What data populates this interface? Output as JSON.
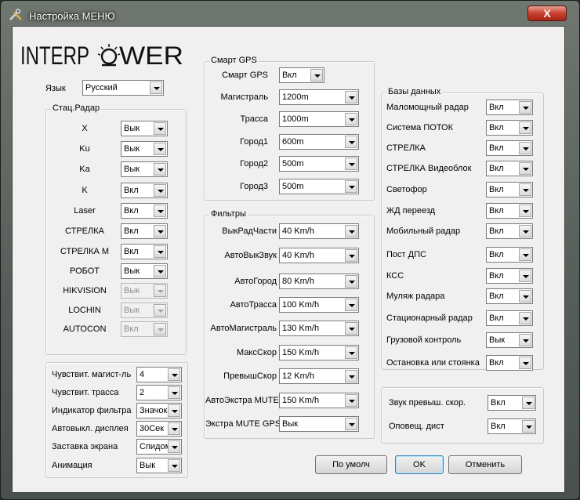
{
  "window": {
    "title": "Настройка МЕНЮ",
    "close_label": "X"
  },
  "logo_text": "INTERPOWER",
  "language": {
    "label": "Язык",
    "value": "Русский"
  },
  "stat_radar": {
    "title": "Стац.Радар",
    "items": [
      {
        "label": "X",
        "value": "Вык",
        "enabled": true
      },
      {
        "label": "Ku",
        "value": "Вык",
        "enabled": true
      },
      {
        "label": "Ka",
        "value": "Вык",
        "enabled": true
      },
      {
        "label": "K",
        "value": "Вкл",
        "enabled": true
      },
      {
        "label": "Laser",
        "value": "Вкл",
        "enabled": true
      },
      {
        "label": "СТРЕЛКА",
        "value": "Вкл",
        "enabled": true
      },
      {
        "label": "СТРЕЛКА М",
        "value": "Вкл",
        "enabled": true
      },
      {
        "label": "РОБОТ",
        "value": "Вык",
        "enabled": true
      },
      {
        "label": "HIKVISION",
        "value": "Вык",
        "enabled": false
      },
      {
        "label": "LOCHIN",
        "value": "Вык",
        "enabled": false
      },
      {
        "label": "AUTOCON",
        "value": "Вкл",
        "enabled": false
      }
    ]
  },
  "misc": {
    "items": [
      {
        "label": "Чувствит. магист-ль",
        "value": "4"
      },
      {
        "label": "Чувствит. трасса",
        "value": "2"
      },
      {
        "label": "Индикатор фильтра",
        "value": "Значок"
      },
      {
        "label": "Автовыкл. дисплея",
        "value": "30Сек"
      },
      {
        "label": "Заставка экрана",
        "value": "Спидом"
      },
      {
        "label": "Анимация",
        "value": "Вык"
      }
    ]
  },
  "smart_gps": {
    "title": "Смарт GPS",
    "items": [
      {
        "label": "Смарт GPS",
        "value": "Вкл"
      },
      {
        "label": "Магистраль",
        "value": "1200m"
      },
      {
        "label": "Трасса",
        "value": "1000m"
      },
      {
        "label": "Город1",
        "value": "600m"
      },
      {
        "label": "Город2",
        "value": "500m"
      },
      {
        "label": "Город3",
        "value": "500m"
      }
    ]
  },
  "filters": {
    "title": "Фильтры",
    "items": [
      {
        "label": "ВыкРадЧасти",
        "value": "40 Km/h"
      },
      {
        "label": "АвтоВыкЗвук",
        "value": "40 Km/h"
      },
      {
        "label": "АвтоГород",
        "value": "80 Km/h"
      },
      {
        "label": "АвтоТрасса",
        "value": "100 Km/h"
      },
      {
        "label": "АвтоМагистраль",
        "value": "130 Km/h"
      },
      {
        "label": "МаксСкор",
        "value": "150 Km/h"
      },
      {
        "label": "ПревышСкор",
        "value": "12 Km/h"
      },
      {
        "label": "АвтоЭкстра MUTE",
        "value": "150 Km/h"
      },
      {
        "label": "Экстра MUTE GPS",
        "value": "Вык"
      }
    ]
  },
  "databases": {
    "title": "Базы данных",
    "items": [
      {
        "label": "Маломощный радар",
        "value": "Вкл"
      },
      {
        "label": "Система ПОТОК",
        "value": "Вкл"
      },
      {
        "label": "СТРЕЛКА",
        "value": "Вкл"
      },
      {
        "label": "СТРЕЛКА Видеоблок",
        "value": "Вкл"
      },
      {
        "label": "Светофор",
        "value": "Вкл"
      },
      {
        "label": "ЖД переезд",
        "value": "Вкл"
      },
      {
        "label": "Мобильный радар",
        "value": "Вкл"
      },
      {
        "label": "Пост ДПС",
        "value": "Вкл"
      },
      {
        "label": "КСС",
        "value": "Вкл"
      },
      {
        "label": "Муляж радара",
        "value": "Вкл"
      },
      {
        "label": "Стационарный радар",
        "value": "Вкл"
      },
      {
        "label": "Грузовой контроль",
        "value": "Вык"
      },
      {
        "label": "Остановка или стоянка",
        "value": "Вкл"
      }
    ]
  },
  "sound": {
    "items": [
      {
        "label": "Звук превыш. скор.",
        "value": "Вкл"
      },
      {
        "label": "Оповещ. дист",
        "value": "Вкл"
      }
    ]
  },
  "buttons": {
    "default_label": "По умолч",
    "ok_label": "OK",
    "cancel_label": "Отменить"
  }
}
